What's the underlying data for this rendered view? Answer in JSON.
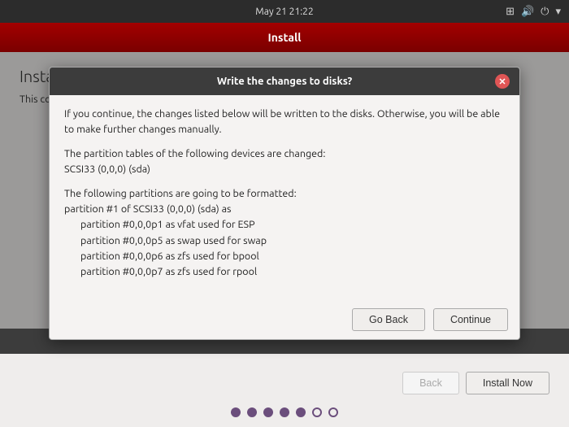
{
  "topbar": {
    "datetime": "May 21  21:22"
  },
  "titlebar": {
    "label": "Install"
  },
  "main": {
    "page_title": "Installation type",
    "description": "This computer currently has no detected operating systems. What would you like to do?"
  },
  "modal": {
    "title": "Write the changes to disks?",
    "body_para1": "If you continue, the changes listed below will be written to the disks. Otherwise, you will be able to make further changes manually.",
    "body_para2_label": "The partition tables of the following devices are changed:",
    "body_para2_value": "SCSI33 (0,0,0) (sda)",
    "body_para3_label": "The following partitions are going to be formatted:",
    "body_para3_line1": "partition #1 of SCSI33 (0,0,0) (sda) as",
    "body_para3_line2": "partition #0,0,0p1 as vfat used for ESP",
    "body_para3_line3": "partition #0,0,0p5 as swap used for swap",
    "body_para3_line4": "partition #0,0,0p6 as zfs used for bpool",
    "body_para3_line5": "partition #0,0,0p7 as zfs used for rpool",
    "go_back_label": "Go Back",
    "continue_label": "Continue"
  },
  "nav": {
    "back_label": "Back",
    "install_label": "Install Now"
  },
  "progress": {
    "dots": [
      {
        "filled": true
      },
      {
        "filled": true
      },
      {
        "filled": true
      },
      {
        "filled": true
      },
      {
        "filled": true
      },
      {
        "filled": false
      },
      {
        "filled": false
      }
    ]
  }
}
